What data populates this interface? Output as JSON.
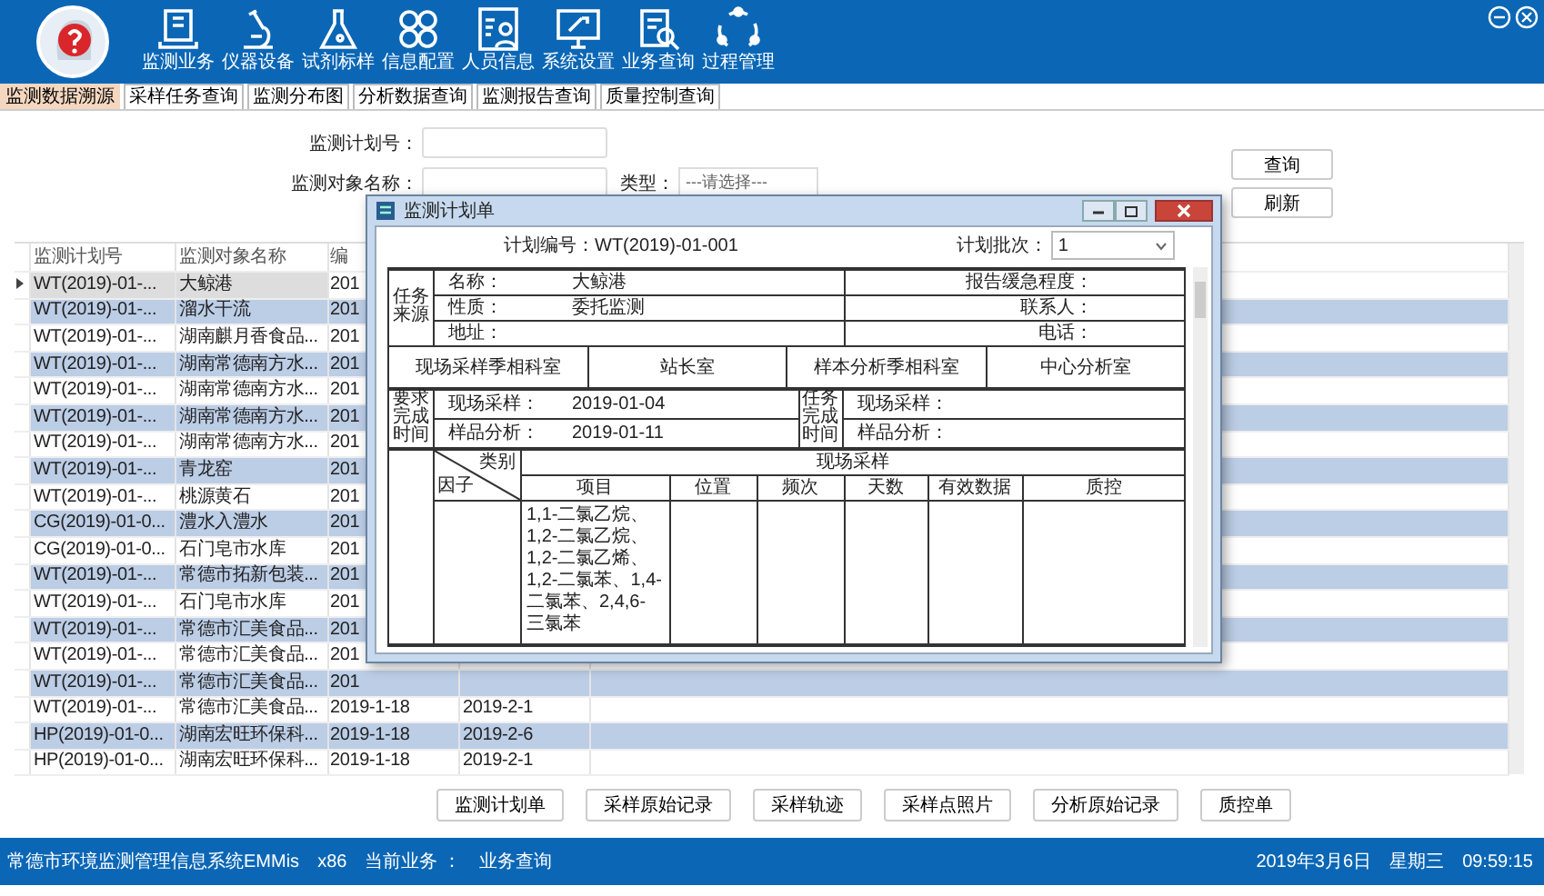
{
  "menu": [
    {
      "label": "监测业务",
      "kind": "book"
    },
    {
      "label": "仪器设备",
      "kind": "microscope"
    },
    {
      "label": "试剂标样",
      "kind": "flask"
    },
    {
      "label": "信息配置",
      "kind": "grid"
    },
    {
      "label": "人员信息",
      "kind": "person"
    },
    {
      "label": "系统设置",
      "kind": "monitor"
    },
    {
      "label": "业务查询",
      "kind": "search"
    },
    {
      "label": "过程管理",
      "kind": "cycle"
    }
  ],
  "tabs": [
    {
      "label": "监测数据溯源",
      "selected": true
    },
    {
      "label": "采样任务查询",
      "selected": false
    },
    {
      "label": "监测分布图",
      "selected": false
    },
    {
      "label": "分析数据查询",
      "selected": false
    },
    {
      "label": "监测报告查询",
      "selected": false
    },
    {
      "label": "质量控制查询",
      "selected": false
    }
  ],
  "search": {
    "fields": [
      {
        "label": "监测计划号："
      },
      {
        "label": "监测对象名称："
      }
    ],
    "type_label": "类型：",
    "type_select": "---请选择---",
    "buttons": [
      "查询",
      "刷新"
    ]
  },
  "table": {
    "columns": {
      "plan_no": "监测计划号",
      "object_name": "监测对象名称",
      "column_3": "编"
    },
    "rows": [
      {
        "plan_no": "WT(2019)-01-...",
        "object_name": "大鲸港",
        "column_3": "201",
        "current": true
      },
      {
        "plan_no": "WT(2019)-01-...",
        "object_name": "溜水干流",
        "column_3": "201",
        "current": false
      },
      {
        "plan_no": "WT(2019)-01-...",
        "object_name": "湖南麒月香食品...",
        "column_3": "201",
        "current": false
      },
      {
        "plan_no": "WT(2019)-01-...",
        "object_name": "湖南常德南方水...",
        "column_3": "201",
        "current": false
      },
      {
        "plan_no": "WT(2019)-01-...",
        "object_name": "湖南常德南方水...",
        "column_3": "201",
        "current": false
      },
      {
        "plan_no": "WT(2019)-01-...",
        "object_name": "湖南常德南方水...",
        "column_3": "201",
        "current": false
      },
      {
        "plan_no": "WT(2019)-01-...",
        "object_name": "湖南常德南方水...",
        "column_3": "201",
        "current": false
      },
      {
        "plan_no": "WT(2019)-01-...",
        "object_name": "青龙窑",
        "column_3": "201",
        "current": false
      },
      {
        "plan_no": "WT(2019)-01-...",
        "object_name": "桃源黄石",
        "column_3": "201",
        "current": false
      },
      {
        "plan_no": "CG(2019)-01-0...",
        "object_name": "澧水入澧水",
        "column_3": "201",
        "current": false
      },
      {
        "plan_no": "CG(2019)-01-0...",
        "object_name": "石门皂市水库",
        "column_3": "201",
        "current": false
      },
      {
        "plan_no": "WT(2019)-01-...",
        "object_name": "常德市拓新包装...",
        "column_3": "201",
        "current": false
      },
      {
        "plan_no": "WT(2019)-01-...",
        "object_name": "石门皂市水库",
        "column_3": "201",
        "current": false
      },
      {
        "plan_no": "WT(2019)-01-...",
        "object_name": "常德市汇美食品...",
        "column_3": "201",
        "current": false
      },
      {
        "plan_no": "WT(2019)-01-...",
        "object_name": "常德市汇美食品...",
        "column_3": "201",
        "current": false
      },
      {
        "plan_no": "WT(2019)-01-...",
        "object_name": "常德市汇美食品...",
        "column_3": "201",
        "current": false
      },
      {
        "plan_no": "WT(2019)-01-...",
        "object_name": "常德市汇美食品...",
        "column_3": "2019-1-18",
        "column_4": "2019-2-1",
        "current": false
      },
      {
        "plan_no": "HP(2019)-01-0...",
        "object_name": "湖南宏旺环保科...",
        "column_3": "2019-1-18",
        "column_4": "2019-2-6",
        "current": false
      },
      {
        "plan_no": "HP(2019)-01-0...",
        "object_name": "湖南宏旺环保科...",
        "column_3": "2019-1-18",
        "column_4": "2019-2-1",
        "current": false
      }
    ]
  },
  "actions": [
    "监测计划单",
    "采样原始记录",
    "采样轨迹",
    "采样点照片",
    "分析原始记录",
    "质控单"
  ],
  "dialog": {
    "title": "监测计划单",
    "plan_no": "计划编号：WT(2019)-01-001",
    "batch_label": "计划批次：",
    "batch_value": "1",
    "source_label": "任务来源",
    "source_rows": [
      {
        "label": "名称：",
        "value": "大鲸港",
        "right_label": "报告缓急程度："
      },
      {
        "label": "性质：",
        "value": "委托监测",
        "right_label": "联系人："
      },
      {
        "label": "地址：",
        "right_label": "电话："
      }
    ],
    "offices": [
      "现场采样季相科室",
      "站长室",
      "样本分析季相科室",
      "中心分析室"
    ],
    "required_label": "要求完成时间",
    "required": [
      {
        "label": "现场采样：",
        "value": "2019-01-04"
      },
      {
        "label": "样品分析：",
        "value": "2019-01-11"
      }
    ],
    "task_label": "任务完成时间",
    "task": [
      {
        "label": "现场采样："
      },
      {
        "label": "样品分析："
      }
    ],
    "category_label": "类别",
    "factor_label": "因子",
    "category": "现场采样",
    "columns": [
      "项目",
      "位置",
      "频次",
      "天数",
      "有效数据",
      "质控"
    ],
    "items": "1,1-二氯乙烷、1,2-二氯乙烷、1,2-二氯乙烯、1,2-二氯苯、1,4-二氯苯、2,4,6-三氯苯"
  },
  "status": {
    "app_name": "常德市环境监测管理信息系统EMMis",
    "arch": "x86",
    "current_label": "当前业务 ：",
    "current": "业务查询",
    "date": "2019年3月6日",
    "weekday": "星期三",
    "time": "09:59:15"
  }
}
